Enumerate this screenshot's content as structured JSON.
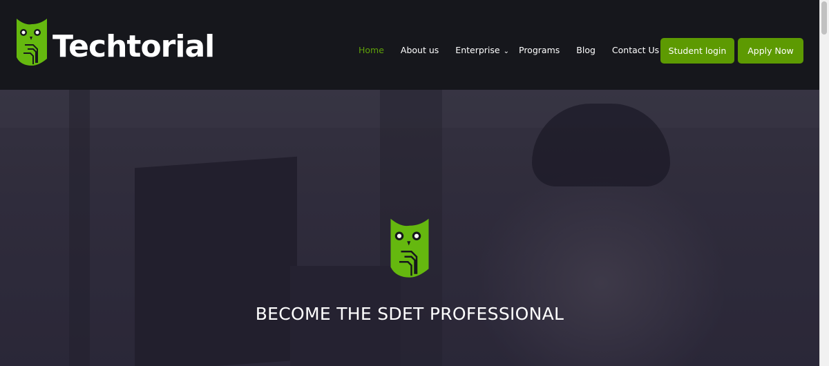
{
  "header": {
    "logo_text": "Techtorial",
    "nav": [
      {
        "label": "Home",
        "active": true
      },
      {
        "label": "About us"
      },
      {
        "label": "Enterprise",
        "has_dropdown": true
      },
      {
        "label": "Programs"
      },
      {
        "label": "Blog"
      },
      {
        "label": "Contact Us"
      }
    ],
    "student_login": "Student login",
    "apply_now": "Apply Now"
  },
  "hero": {
    "title": "BECOME THE SDET PROFESSIONAL"
  },
  "colors": {
    "accent": "#5d9a02",
    "header_bg": "#16171c",
    "active_nav": "#5fa10a"
  }
}
